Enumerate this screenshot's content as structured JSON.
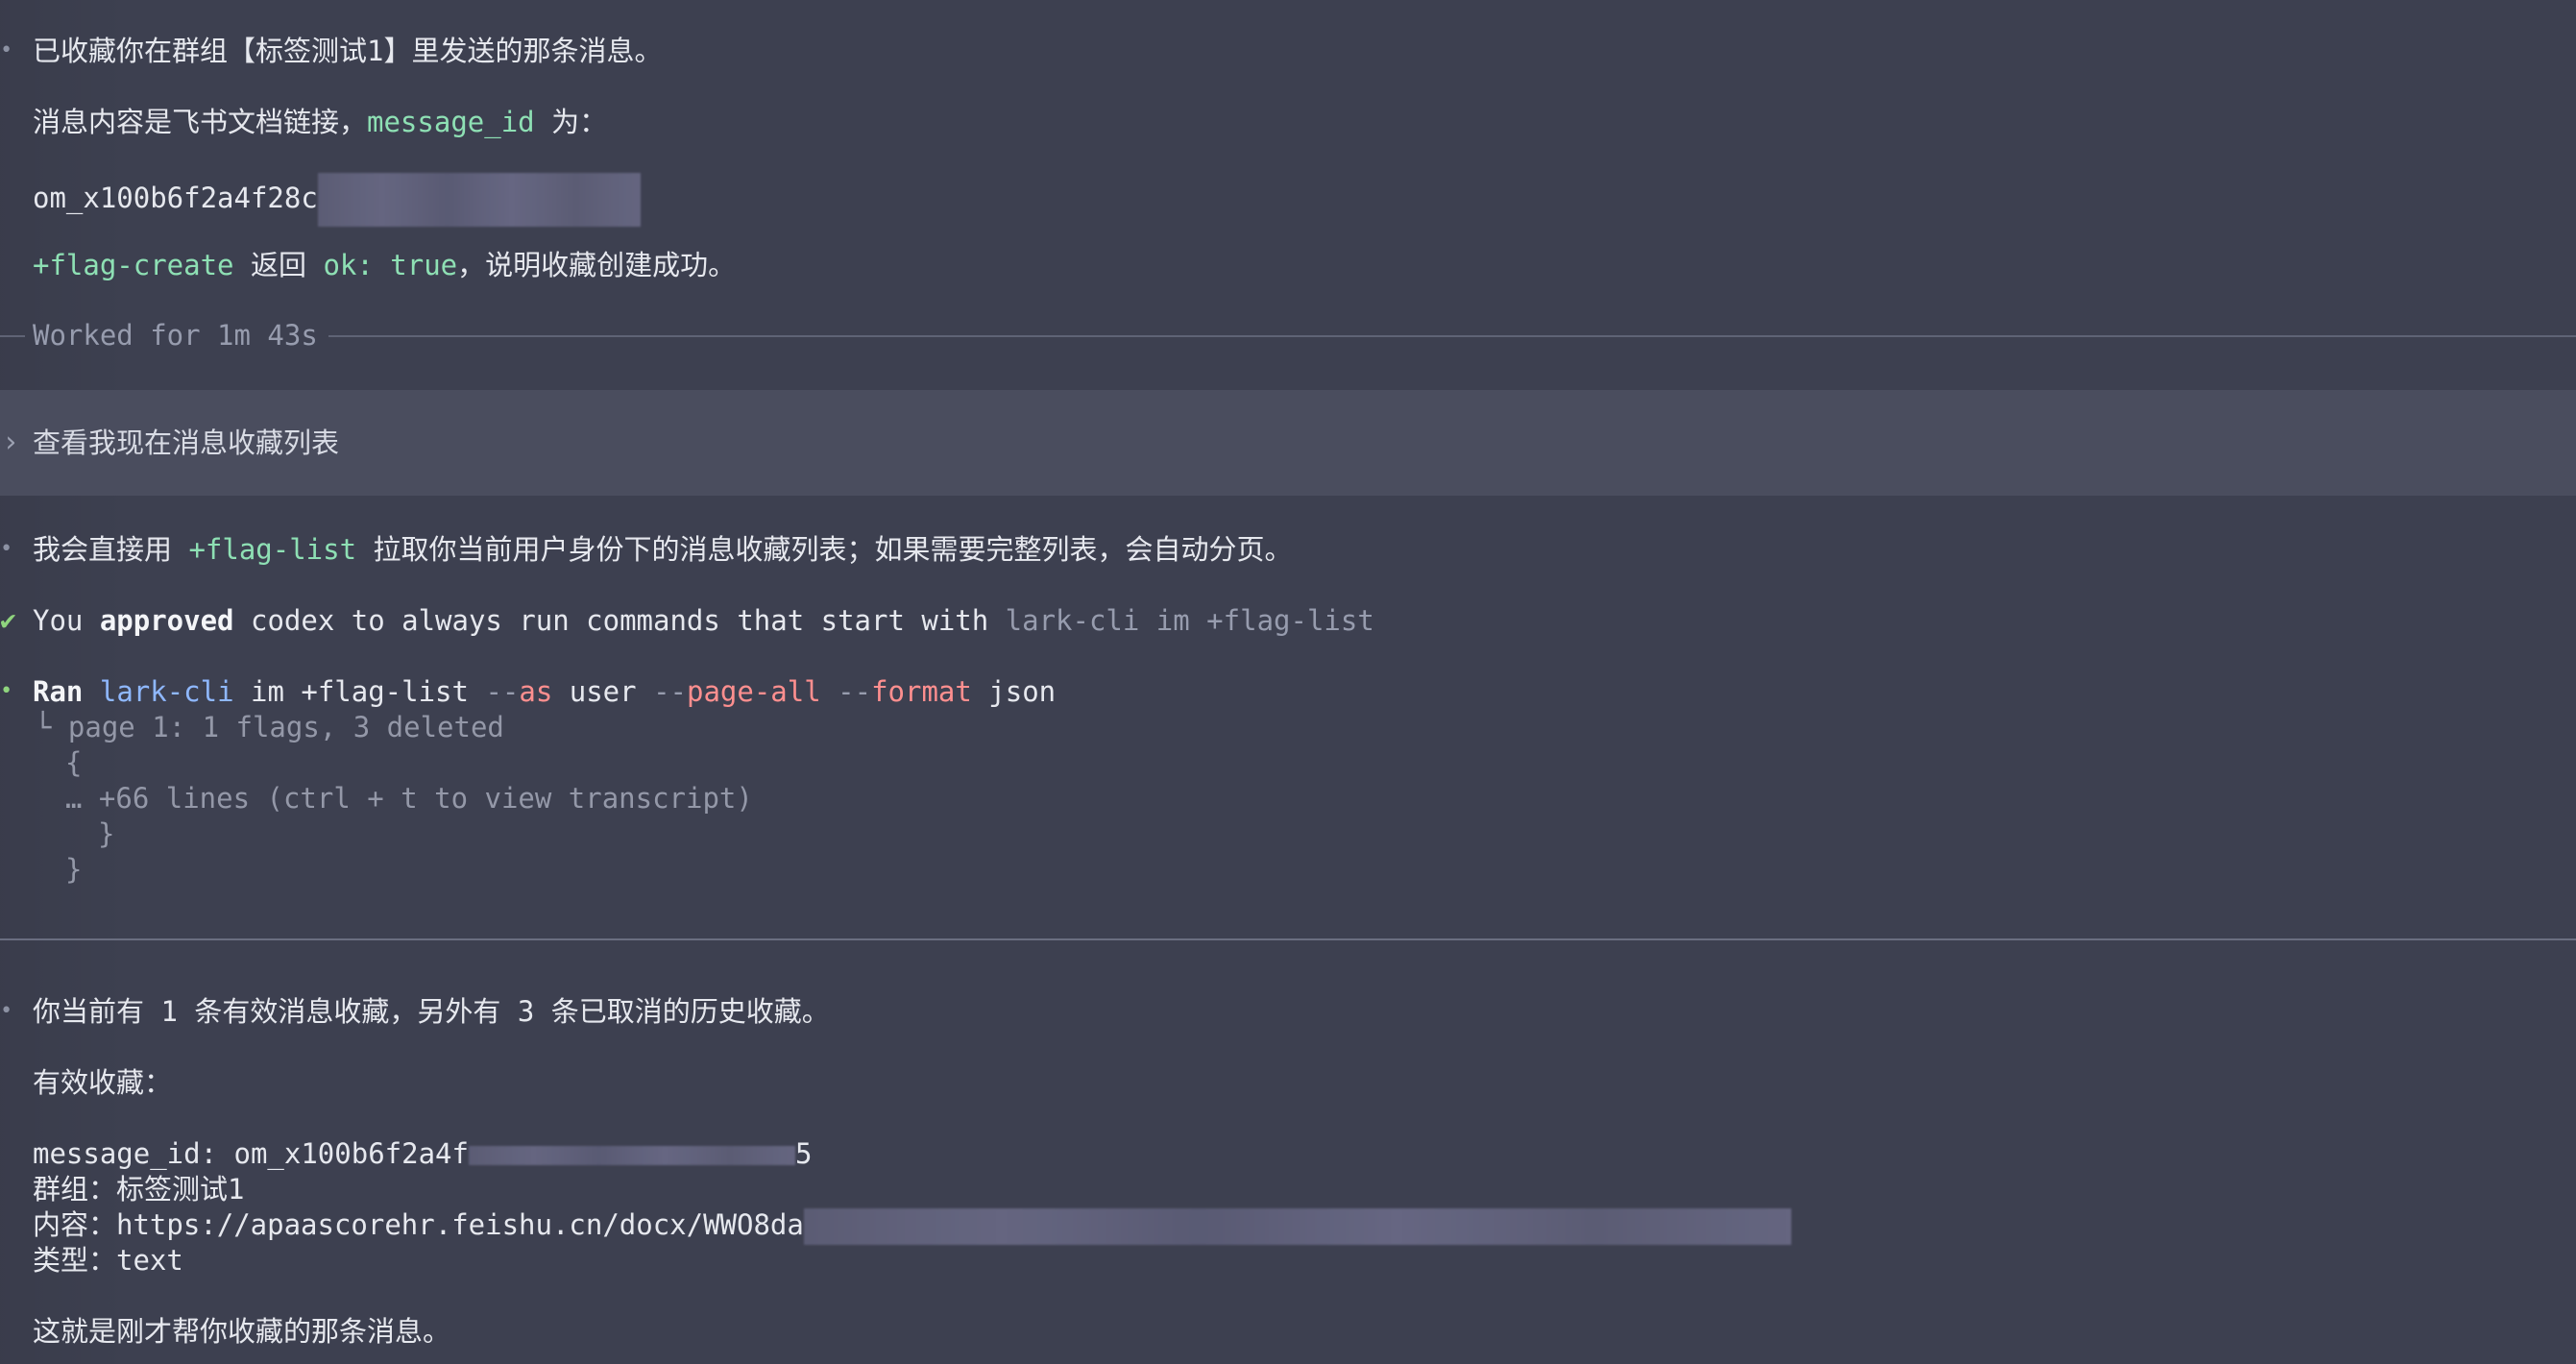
{
  "prev_reply": {
    "line1": "已收藏你在群组【标签测试1】里发送的那条消息。",
    "line2_pre": "消息内容是飞书文档链接，",
    "line2_code": "message_id",
    "line2_post": " 为：",
    "message_id_visible": "om_x100b6f2a4f28c",
    "line4_cmd": "+flag-create",
    "line4_mid": " 返回 ",
    "line4_ok": "ok: true",
    "line4_post": "，说明收藏创建成功。"
  },
  "worked_label": "Worked for 1m 43s",
  "user_prompt": "查看我现在消息收藏列表",
  "reply2": {
    "pre": "我会直接用 ",
    "cmd": "+flag-list",
    "post": " 拉取你当前用户身份下的消息收藏列表；如果需要完整列表，会自动分页。"
  },
  "approval": {
    "you": "You ",
    "approved": "approved",
    "mid": " codex to always run commands that start with ",
    "prefix": "lark-cli im +flag-list"
  },
  "ran": {
    "label": "Ran",
    "cli": "lark-cli",
    "args1": " im +flag-list ",
    "dash1": "--",
    "flag1": "as",
    "args2": " user ",
    "dash2": "--",
    "flag2": "page-all",
    "args3": " ",
    "dash3": "--",
    "flag3": "format",
    "args4": " json",
    "out1": "└ page 1: 1 flags, 3 deleted",
    "out2": "{",
    "out3": "… +66 lines (ctrl + t to view transcript)",
    "out4": "}",
    "out5": "}"
  },
  "result": {
    "line1": "你当前有 1 条有效消息收藏，另外有 3 条已取消的历史收藏。",
    "heading": "有效收藏：",
    "msg_id": "message_id: om_x100b6f2a4f",
    "msg_id_tail": "5",
    "group": "群组：标签测试1",
    "content": "内容：https://apaascorehr.feishu.cn/docx/WWO8da",
    "type": "类型：text",
    "closing": "这就是刚才帮你收藏的那条消息。"
  },
  "colors": {
    "background": "#3d4050",
    "user_block": "#4a4d5e",
    "code_green": "#8ee0b4",
    "flag_red": "#ff8f8f",
    "cli_blue": "#8fb8ff",
    "check_green": "#8fd47e"
  }
}
